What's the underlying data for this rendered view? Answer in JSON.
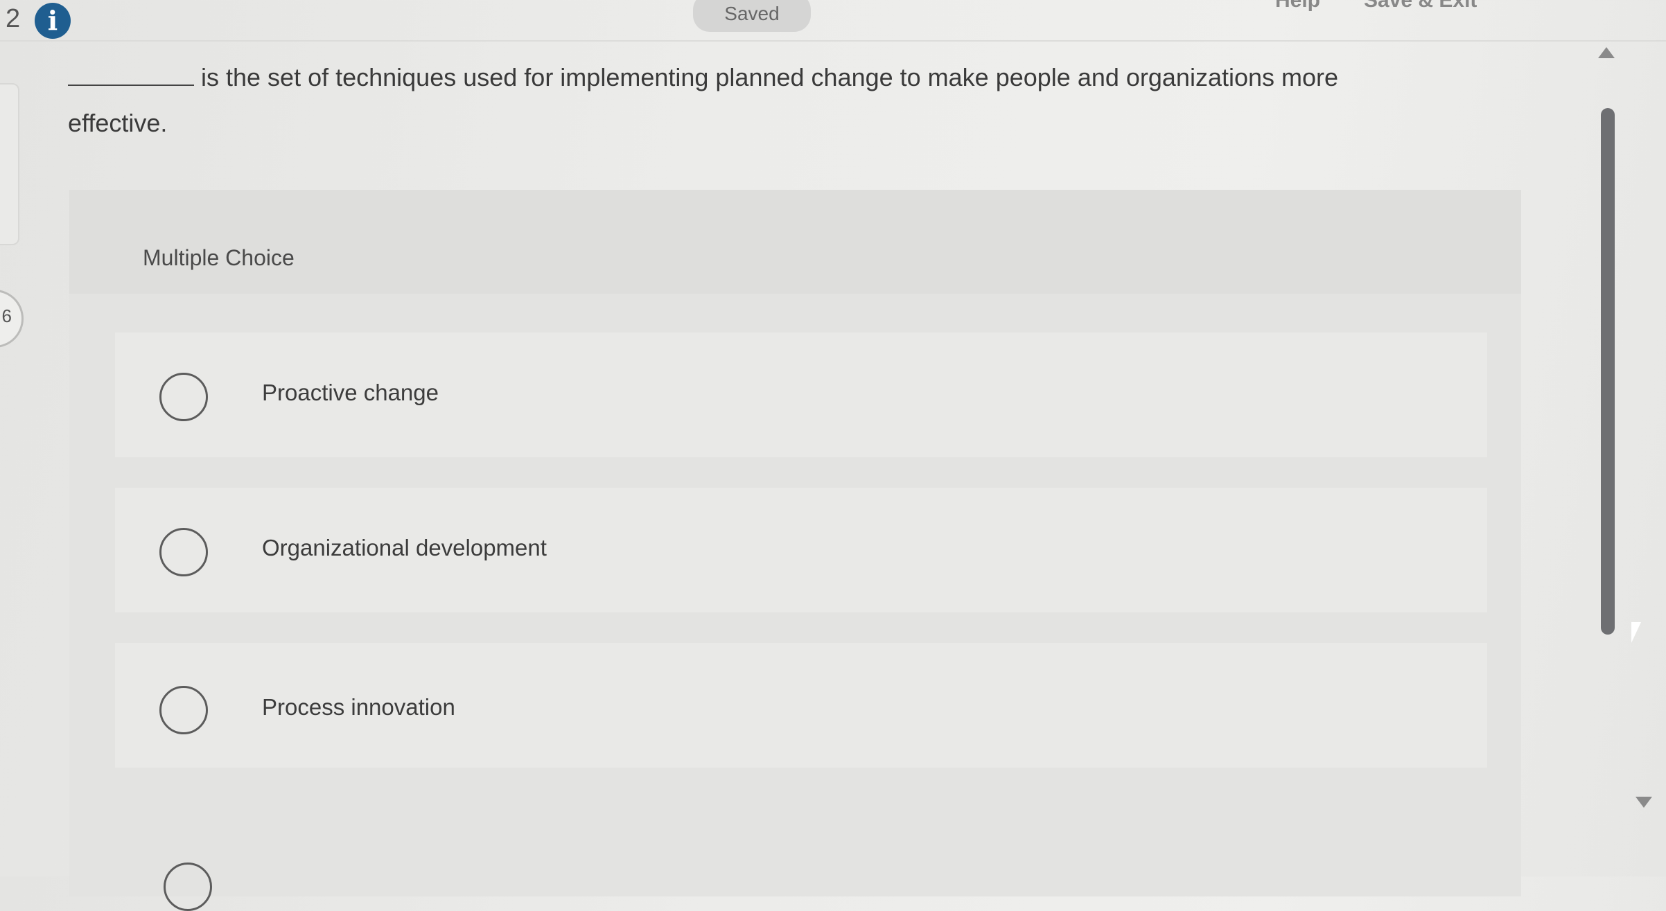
{
  "header": {
    "question_number": "2",
    "info_icon": "info-icon",
    "status_label": "Saved",
    "help_label": "Help",
    "save_exit_label": "Save & Exit"
  },
  "side": {
    "progress_number": "6"
  },
  "question": {
    "text_line": "is the set of techniques used for implementing planned change to make people and organizations more effective."
  },
  "answer_area": {
    "type_label": "Multiple Choice",
    "options": [
      {
        "label": "Proactive change",
        "selected": false
      },
      {
        "label": "Organizational development",
        "selected": false
      },
      {
        "label": "Process innovation",
        "selected": false
      }
    ]
  },
  "icons": {
    "scroll_up": "triangle-up-icon",
    "scroll_down": "triangle-down-icon",
    "cursor": "mouse-pointer-icon"
  }
}
